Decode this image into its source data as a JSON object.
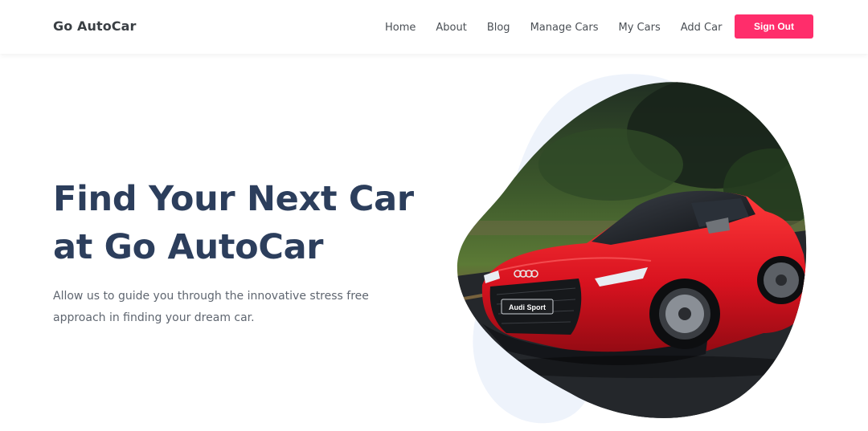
{
  "brand": "Go AutoCar",
  "nav": {
    "items": [
      "Home",
      "About",
      "Blog",
      "Manage Cars",
      "My Cars",
      "Add Car"
    ],
    "signout_label": "Sign Out"
  },
  "hero": {
    "title_line1": "Find Your Next Car",
    "title_line2": "at Go AutoCar",
    "subtitle": "Allow us to guide you through the innovative stress free approach in finding your dream car.",
    "plate_text": "Audi Sport"
  },
  "colors": {
    "accent": "#ff2d6b",
    "heading": "#2c3e5c",
    "blob_bg": "#eef3fb",
    "car_red": "#d8121f"
  }
}
